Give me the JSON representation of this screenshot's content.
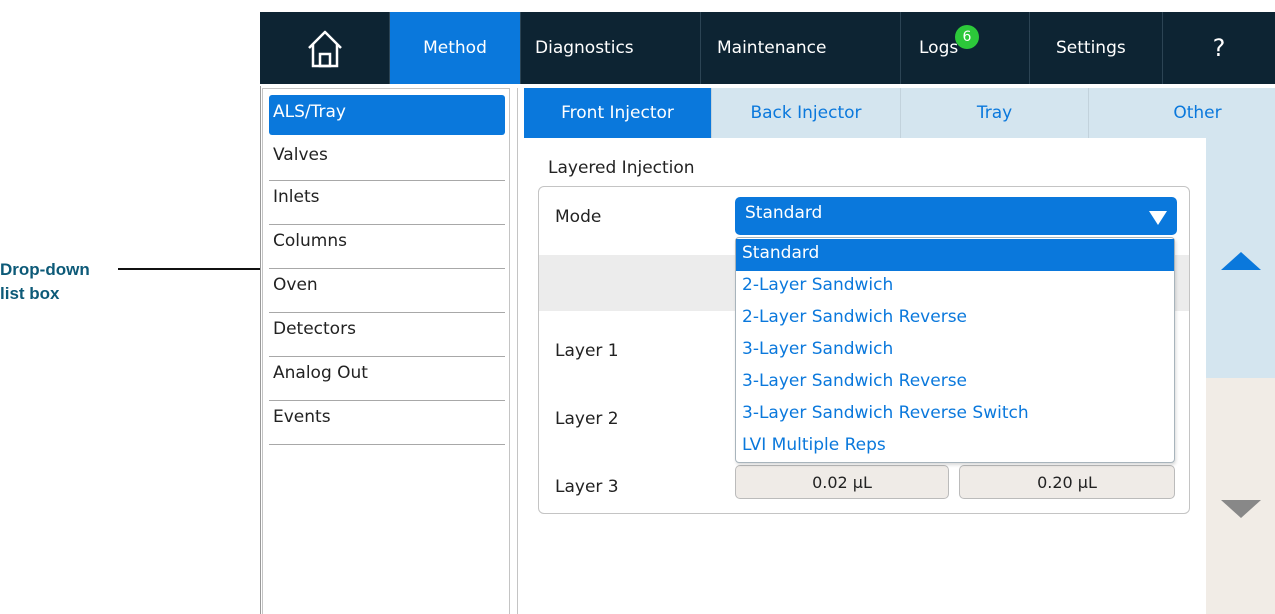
{
  "callout": {
    "line1": "Drop-down",
    "line2": "list box"
  },
  "nav": {
    "home_icon": "home-icon",
    "method": "Method",
    "diagnostics": "Diagnostics",
    "maintenance": "Maintenance",
    "logs": "Logs",
    "logs_badge": "6",
    "settings": "Settings",
    "help": "?"
  },
  "sidebar": {
    "items": [
      {
        "label": "ALS/Tray"
      },
      {
        "label": "Valves"
      },
      {
        "label": "Inlets"
      },
      {
        "label": "Columns"
      },
      {
        "label": "Oven"
      },
      {
        "label": "Detectors"
      },
      {
        "label": "Analog Out"
      },
      {
        "label": "Events"
      }
    ]
  },
  "tabs": {
    "front": "Front Injector",
    "back": "Back Injector",
    "tray": "Tray",
    "other": "Other"
  },
  "main": {
    "section_title": "Layered Injection",
    "mode_label": "Mode",
    "mode_value": "Standard",
    "layer1_label": "Layer 1",
    "layer2_label": "Layer 2",
    "layer3_label": "Layer 3",
    "layer3_value1": "0.02 µL",
    "layer3_value2": "0.20 µL"
  },
  "dropdown": {
    "options": [
      "Standard",
      "2-Layer Sandwich",
      "2-Layer Sandwich Reverse",
      "3-Layer Sandwich",
      "3-Layer Sandwich Reverse",
      "3-Layer Sandwich Reverse Switch",
      "LVI Multiple Reps"
    ]
  },
  "colors": {
    "nav_bg": "#0d2433",
    "accent": "#0a78dc",
    "badge": "#2cc83a",
    "callout_text": "#0d5a78"
  }
}
